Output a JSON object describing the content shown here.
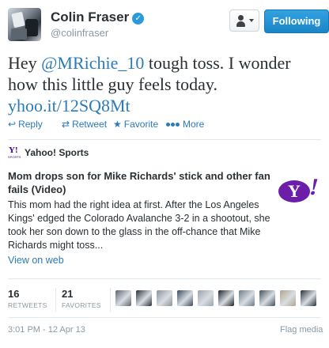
{
  "header": {
    "display_name": "Colin Fraser",
    "handle": "@colinfraser",
    "verified_icon": "checkmark-icon",
    "follow_label": "Following"
  },
  "tweet": {
    "prefix": "Hey ",
    "mention": "@MRichie_10",
    "middle": " tough toss. I wonder how this little guy feels today.",
    "link": "yhoo.it/12SQ8Mt"
  },
  "actions": {
    "reply": "Reply",
    "retweet": "Retweet",
    "favorite": "Favorite",
    "more": "More"
  },
  "card": {
    "source_logo_text": "Y!",
    "source_logo_sub": "SPORTS",
    "source_name": "Yahoo! Sports",
    "title": "Mom drops son for Mike Richards' stick and other fan fails (Video)",
    "description": "This mom had the right idea at first. After the Los Angeles Kings' edged the Colorado Avalanche 3-2 in a shootout, she took her son down to the glass in the off-chance that Mike Richards might toss...",
    "logo_text": "Y",
    "logo_bang": "!",
    "view_on_web": "View on web"
  },
  "stats": {
    "retweets_count": "16",
    "retweets_label": "RETWEETS",
    "favorites_count": "21",
    "favorites_label": "FAVORITES"
  },
  "favoriters": [
    {
      "color": "#5c646c"
    },
    {
      "color": "#2a3038"
    },
    {
      "color": "#8a929a"
    },
    {
      "color": "#3a4a5e"
    },
    {
      "color": "#9aa3ab"
    },
    {
      "color": "#1e2329"
    },
    {
      "color": "#6b7b8b"
    },
    {
      "color": "#44505c"
    },
    {
      "color": "#b0a48a"
    },
    {
      "color": "#28313b"
    }
  ],
  "footer": {
    "timestamp": "3:01 PM - 12 Apr 13",
    "flag_media": "Flag media"
  },
  "colors": {
    "link": "#2b7bb9",
    "follow_button": "#1a86c8",
    "yahoo_purple": "#6c1ea8"
  }
}
